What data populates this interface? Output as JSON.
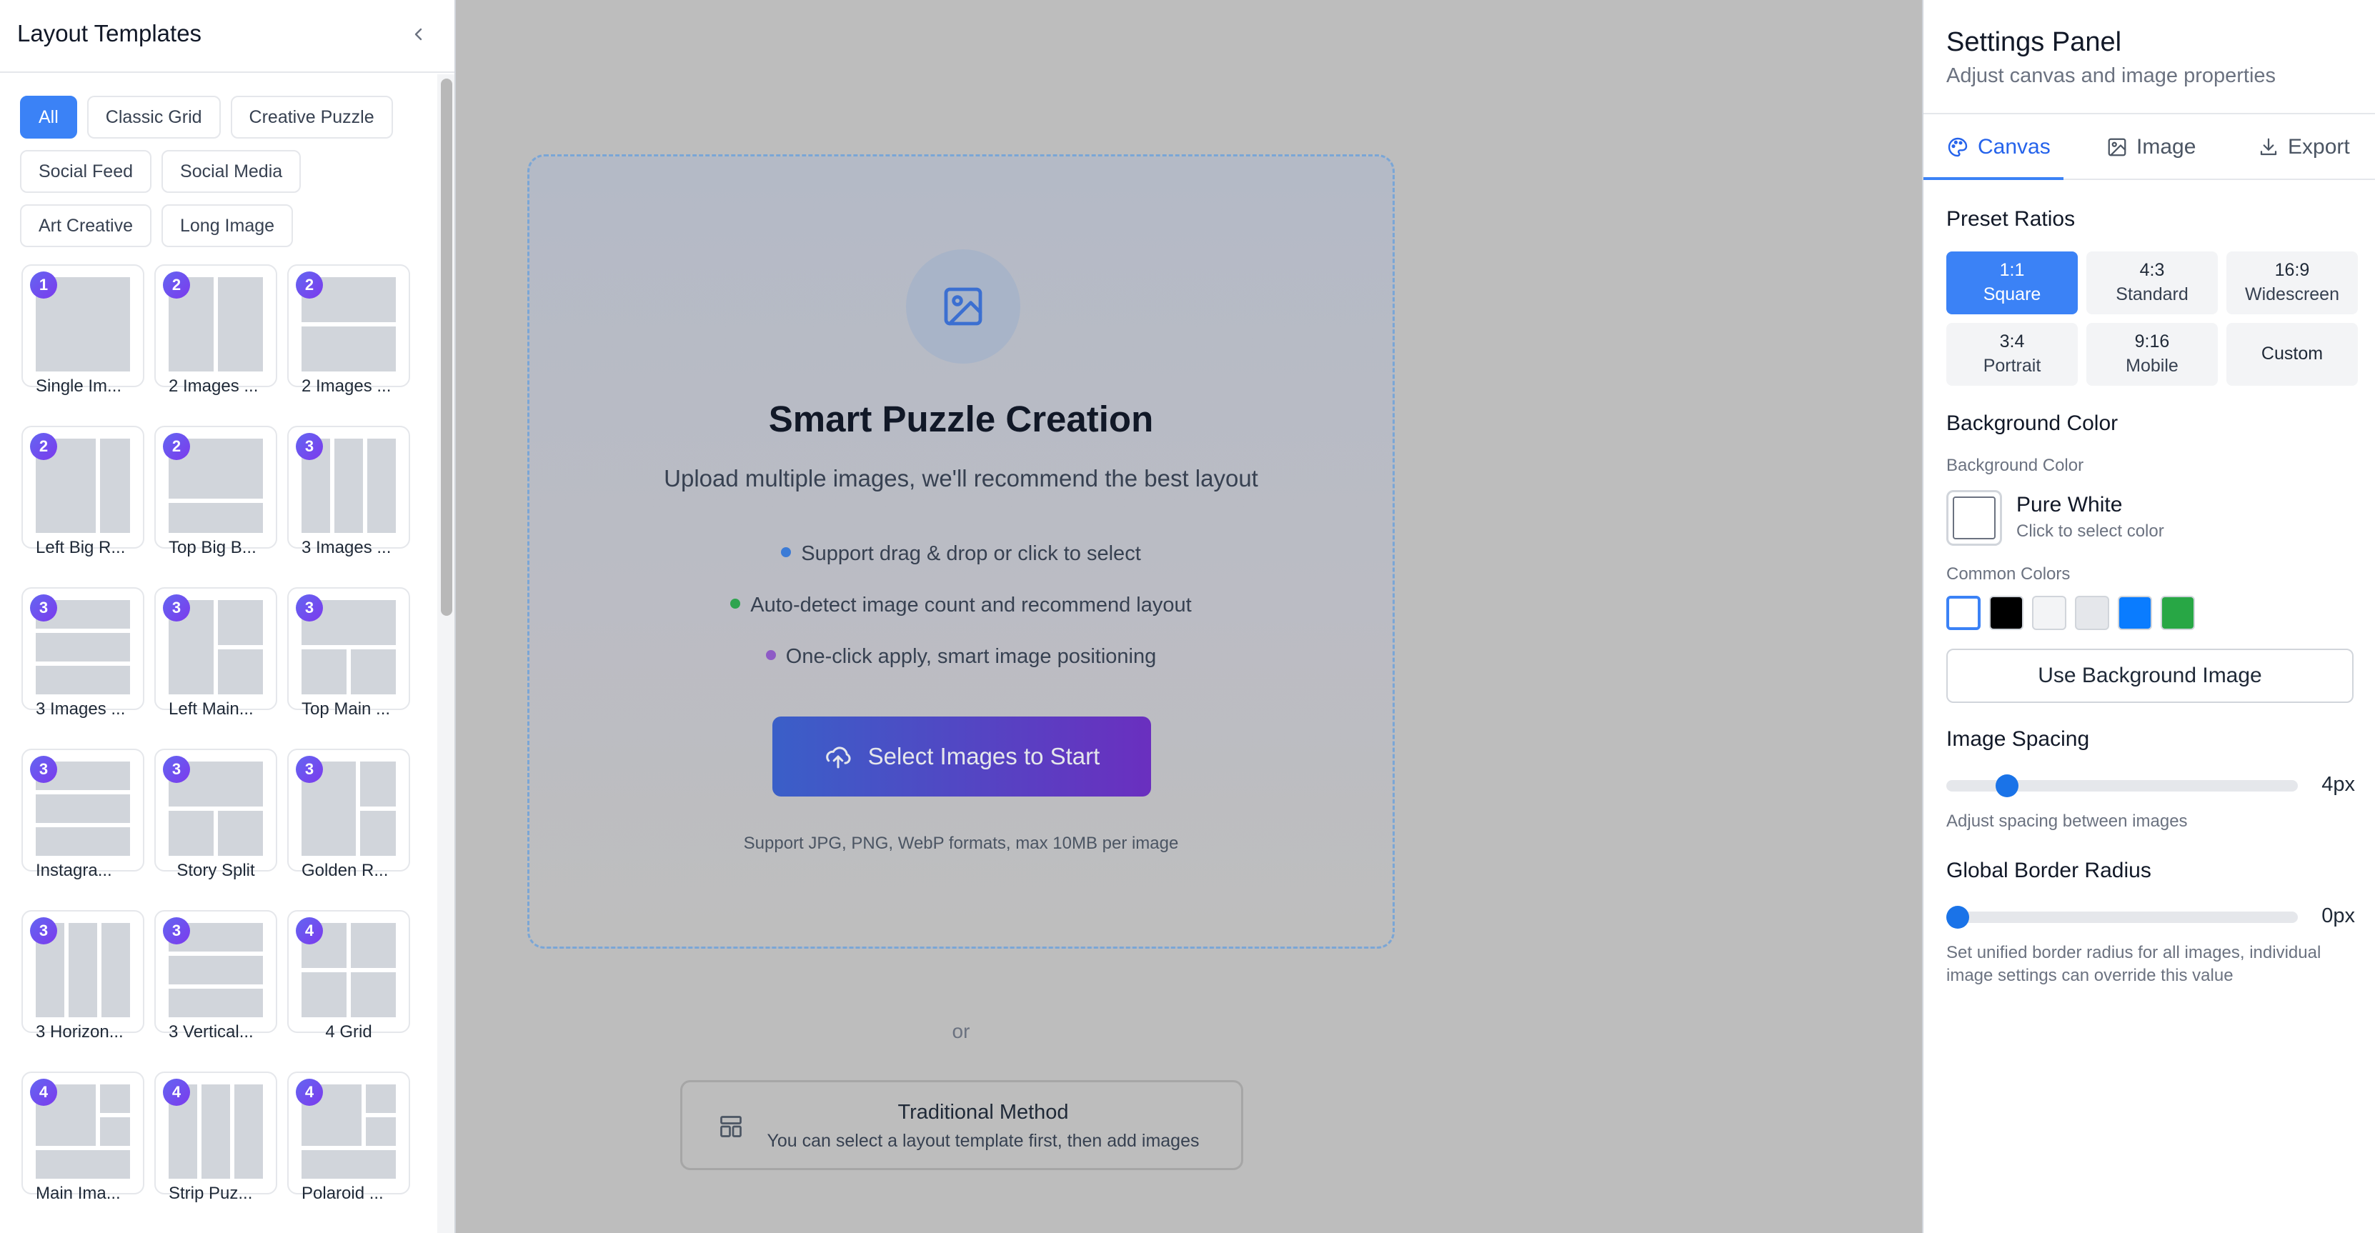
{
  "left_panel": {
    "title": "Layout Templates",
    "filters": [
      {
        "label": "All",
        "active": true
      },
      {
        "label": "Classic Grid",
        "active": false
      },
      {
        "label": "Creative Puzzle",
        "active": false
      },
      {
        "label": "Social Feed",
        "active": false
      },
      {
        "label": "Social Media",
        "active": false
      },
      {
        "label": "Art Creative",
        "active": false
      },
      {
        "label": "Long Image",
        "active": false
      }
    ],
    "templates": [
      {
        "count": "1",
        "label": "Single Im..."
      },
      {
        "count": "2",
        "label": "2 Images ..."
      },
      {
        "count": "2",
        "label": "2 Images ..."
      },
      {
        "count": "2",
        "label": "Left Big R..."
      },
      {
        "count": "2",
        "label": "Top Big B..."
      },
      {
        "count": "3",
        "label": "3 Images ..."
      },
      {
        "count": "3",
        "label": "3 Images ..."
      },
      {
        "count": "3",
        "label": "Left Main..."
      },
      {
        "count": "3",
        "label": "Top Main ..."
      },
      {
        "count": "3",
        "label": "Instagra..."
      },
      {
        "count": "3",
        "label": "Story Split"
      },
      {
        "count": "3",
        "label": "Golden R..."
      },
      {
        "count": "3",
        "label": "3 Horizon..."
      },
      {
        "count": "3",
        "label": "3 Vertical..."
      },
      {
        "count": "4",
        "label": "4 Grid"
      },
      {
        "count": "4",
        "label": "Main Ima..."
      },
      {
        "count": "4",
        "label": "Strip Puz..."
      },
      {
        "count": "4",
        "label": "Polaroid ..."
      }
    ]
  },
  "center": {
    "title": "Smart Puzzle Creation",
    "subtitle": "Upload multiple images, we'll recommend the best layout",
    "features": [
      {
        "text": "Support drag & drop or click to select",
        "color": "#3b7bd6"
      },
      {
        "text": "Auto-detect image count and recommend layout",
        "color": "#2ea44f"
      },
      {
        "text": "One-click apply, smart image positioning",
        "color": "#8e5bc6"
      }
    ],
    "cta_label": "Select Images to Start",
    "formats_note": "Support JPG, PNG, WebP formats, max 10MB per image",
    "or_text": "or",
    "traditional_title": "Traditional Method",
    "traditional_desc": "You can select a layout template first, then add images"
  },
  "settings": {
    "title": "Settings Panel",
    "subtitle": "Adjust canvas and image properties",
    "tabs": [
      {
        "label": "Canvas",
        "icon": "palette-icon",
        "active": true
      },
      {
        "label": "Image",
        "icon": "image-icon",
        "active": false
      },
      {
        "label": "Export",
        "icon": "download-icon",
        "active": false
      }
    ],
    "preset_ratios_title": "Preset Ratios",
    "ratios": [
      {
        "ratio": "1:1",
        "name": "Square",
        "active": true
      },
      {
        "ratio": "4:3",
        "name": "Standard",
        "active": false
      },
      {
        "ratio": "16:9",
        "name": "Widescreen",
        "active": false
      },
      {
        "ratio": "3:4",
        "name": "Portrait",
        "active": false
      },
      {
        "ratio": "9:16",
        "name": "Mobile",
        "active": false
      },
      {
        "ratio": "",
        "name": "Custom",
        "active": false
      }
    ],
    "background_section_title": "Background Color",
    "background_label": "Background Color",
    "background_color_name": "Pure White",
    "background_color_hint": "Click to select color",
    "common_colors_label": "Common Colors",
    "common_colors": [
      "#ffffff",
      "#000000",
      "#f3f4f6",
      "#e5e7eb",
      "#0a7cff",
      "#28a745"
    ],
    "use_bg_image_label": "Use Background Image",
    "spacing_title": "Image Spacing",
    "spacing_value": "4px",
    "spacing_fraction": 0.15,
    "spacing_hint": "Adjust spacing between images",
    "radius_title": "Global Border Radius",
    "radius_value": "0px",
    "radius_fraction": 0.0,
    "radius_hint_line1": "Set unified border radius for all images, individual",
    "radius_hint_line2": "image settings can override this value"
  },
  "colors": {
    "accent": "#3b82f6",
    "badge": "#6d28d9"
  }
}
